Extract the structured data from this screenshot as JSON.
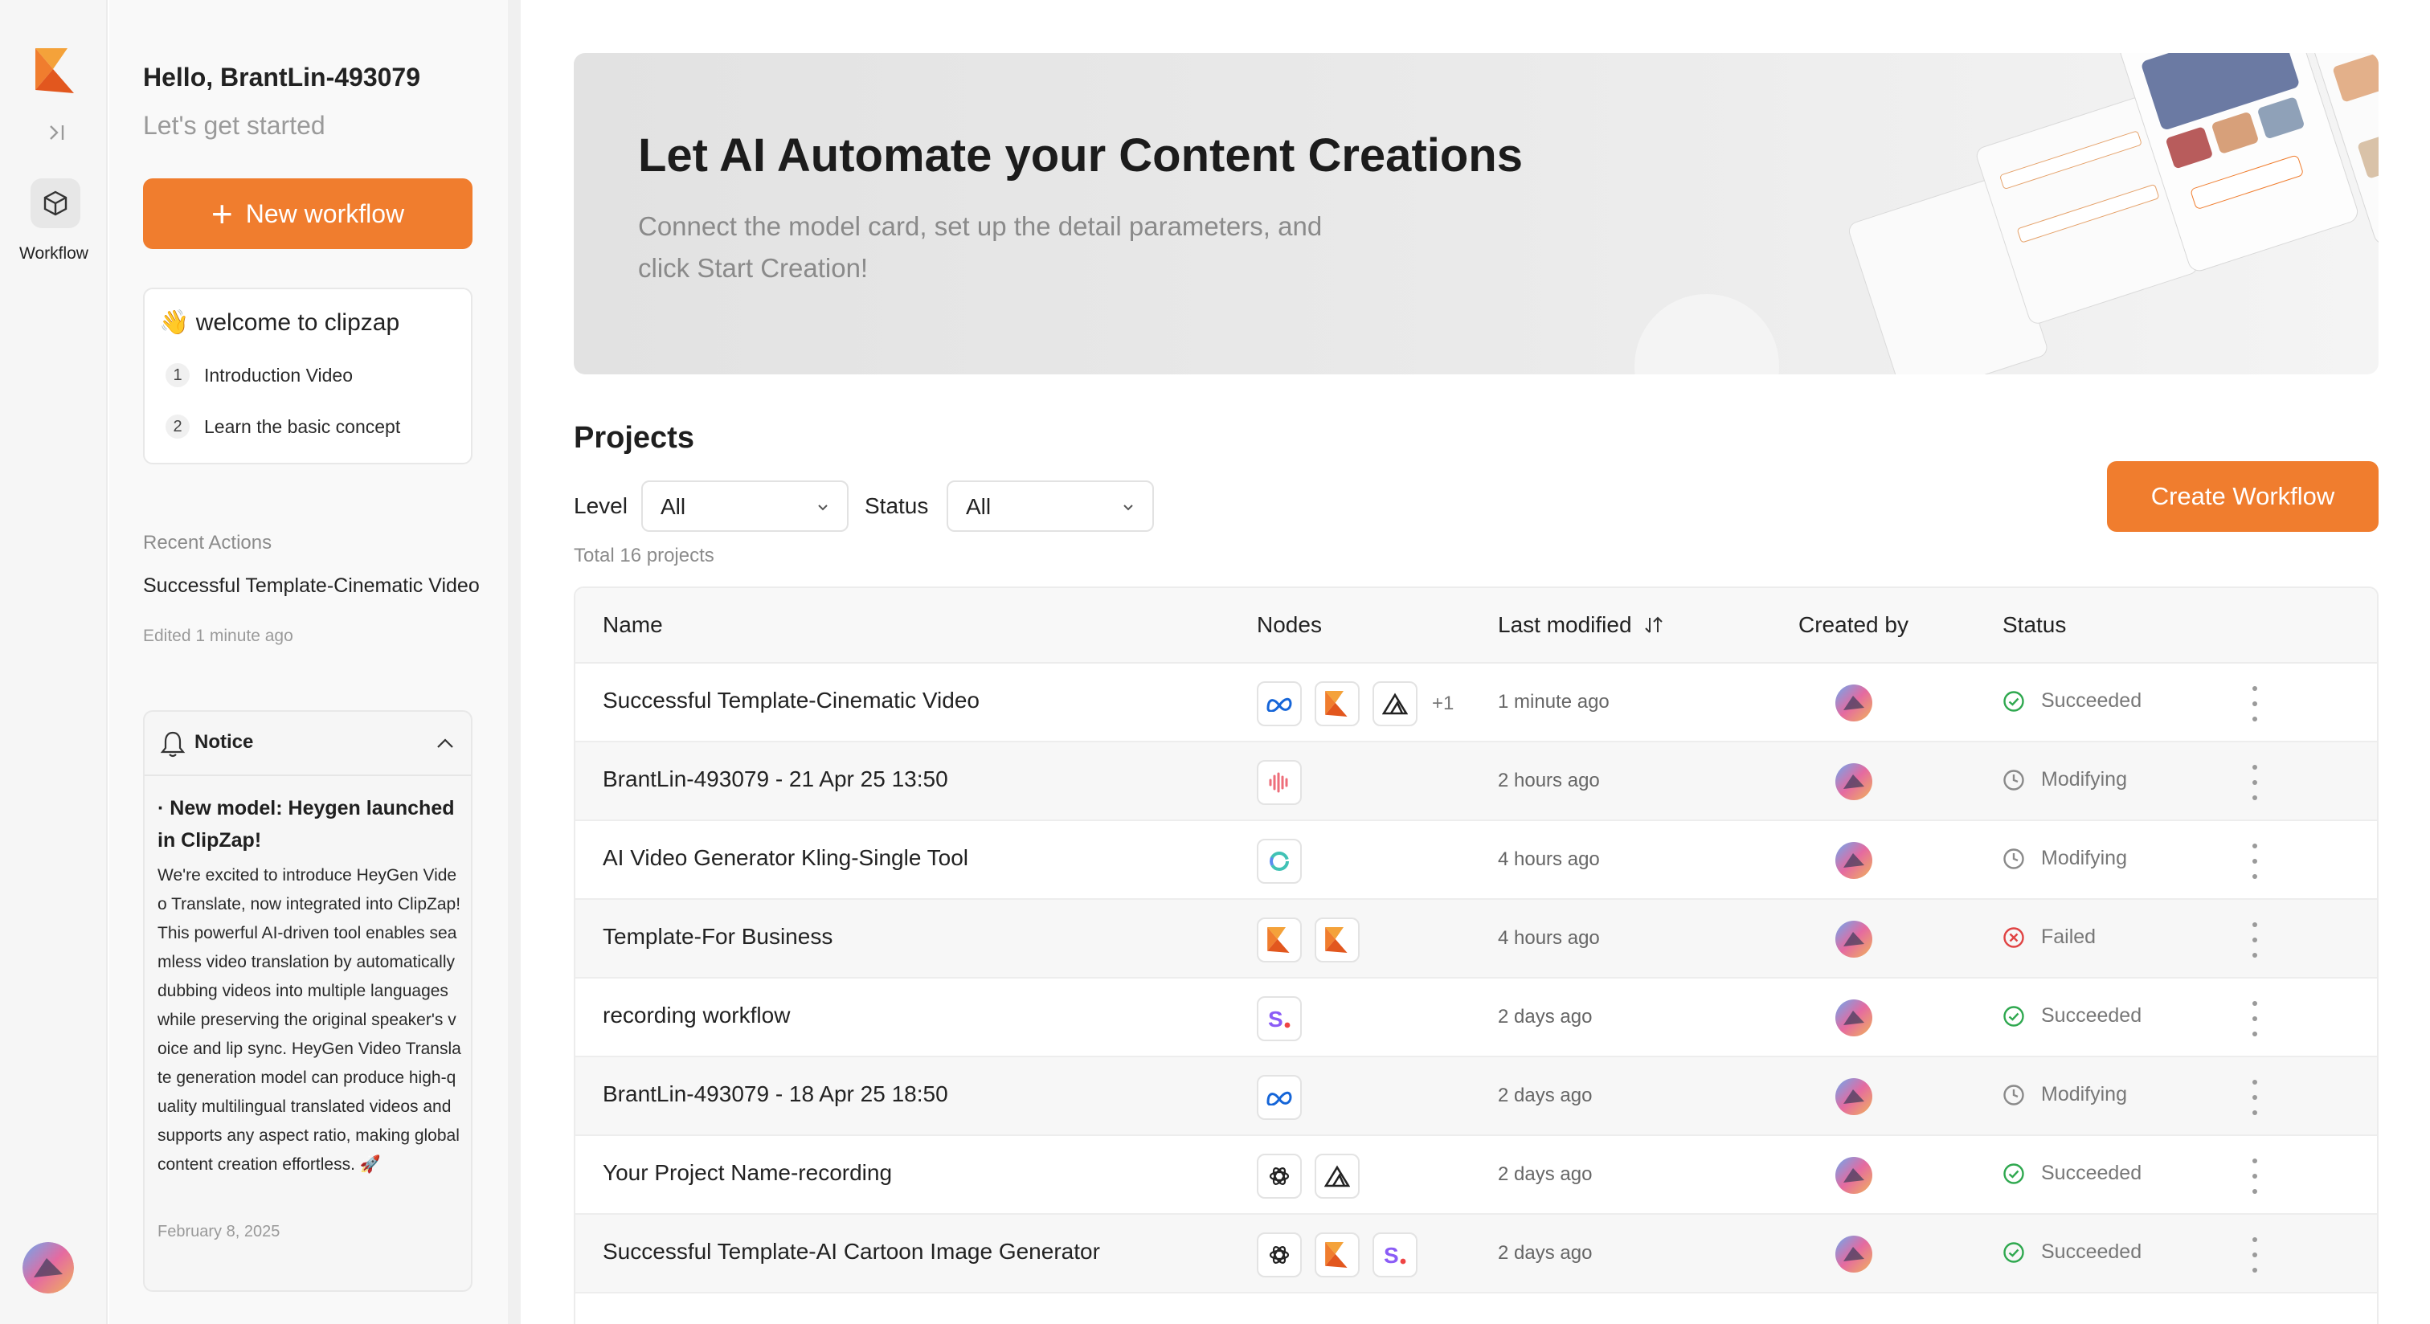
{
  "rail": {
    "workflow_label": "Workflow"
  },
  "sidebar": {
    "greeting": "Hello, BrantLin-493079",
    "subtitle": "Let's get started",
    "new_workflow_label": "New workflow",
    "welcome": {
      "title": "👋 welcome to clipzap",
      "items": [
        {
          "num": "1",
          "label": "Introduction Video"
        },
        {
          "num": "2",
          "label": "Learn the basic concept"
        }
      ]
    },
    "recent": {
      "heading": "Recent Actions",
      "title": "Successful Template-Cinematic Video",
      "subtitle": "Edited 1 minute ago"
    },
    "notice": {
      "heading": "Notice",
      "headline": "· New model: Heygen launched in ClipZap!",
      "body": "We're excited to introduce HeyGen Video Translate, now integrated into ClipZap! This powerful AI-driven tool enables seamless video translation by automatically dubbing videos into multiple languages while preserving the original speaker's voice and lip sync. HeyGen Video Translate generation model can produce high-quality multilingual translated videos and supports any aspect ratio, making global content creation effortless. 🚀",
      "date": "February 8, 2025"
    }
  },
  "banner": {
    "title": "Let AI Automate your Content Creations",
    "subtitle": "Connect the model card, set up the detail parameters, and click Start Creation!"
  },
  "projects": {
    "heading": "Projects",
    "level_label": "Level",
    "level_value": "All",
    "status_label": "Status",
    "status_value": "All",
    "total": "Total 16 projects",
    "create_label": "Create Workflow",
    "columns": {
      "name": "Name",
      "nodes": "Nodes",
      "modified": "Last modified",
      "created_by": "Created by",
      "status": "Status"
    },
    "rows": [
      {
        "name": "Successful Template-Cinematic Video",
        "nodes": [
          "meta-icon",
          "clipzap-icon",
          "triangle-icon"
        ],
        "extra": "+1",
        "time": "1 minute ago",
        "status": "Succeeded"
      },
      {
        "name": "BrantLin-493079 - 21 Apr 25 13:50",
        "nodes": [
          "audio-wave-icon"
        ],
        "extra": "",
        "time": "2 hours ago",
        "status": "Modifying"
      },
      {
        "name": "AI Video Generator Kling-Single Tool",
        "nodes": [
          "kling-icon"
        ],
        "extra": "",
        "time": "4 hours ago",
        "status": "Modifying"
      },
      {
        "name": "Template-For Business",
        "nodes": [
          "clipzap-icon",
          "clipzap-icon"
        ],
        "extra": "",
        "time": "4 hours ago",
        "status": "Failed"
      },
      {
        "name": "recording workflow",
        "nodes": [
          "s-icon"
        ],
        "extra": "",
        "time": "2 days ago",
        "status": "Succeeded"
      },
      {
        "name": "BrantLin-493079 - 18 Apr 25 18:50",
        "nodes": [
          "meta-icon"
        ],
        "extra": "",
        "time": "2 days ago",
        "status": "Modifying"
      },
      {
        "name": "Your Project Name-recording",
        "nodes": [
          "openai-icon",
          "triangle-icon"
        ],
        "extra": "",
        "time": "2 days ago",
        "status": "Succeeded"
      },
      {
        "name": "Successful Template-AI Cartoon Image Generator",
        "nodes": [
          "openai-icon",
          "clipzap-icon",
          "s-icon"
        ],
        "extra": "",
        "time": "2 days ago",
        "status": "Succeeded"
      }
    ]
  },
  "colors": {
    "accent": "#f07d2e",
    "success": "#2fa84f",
    "failed": "#e04343",
    "muted": "#8a8a8a"
  }
}
